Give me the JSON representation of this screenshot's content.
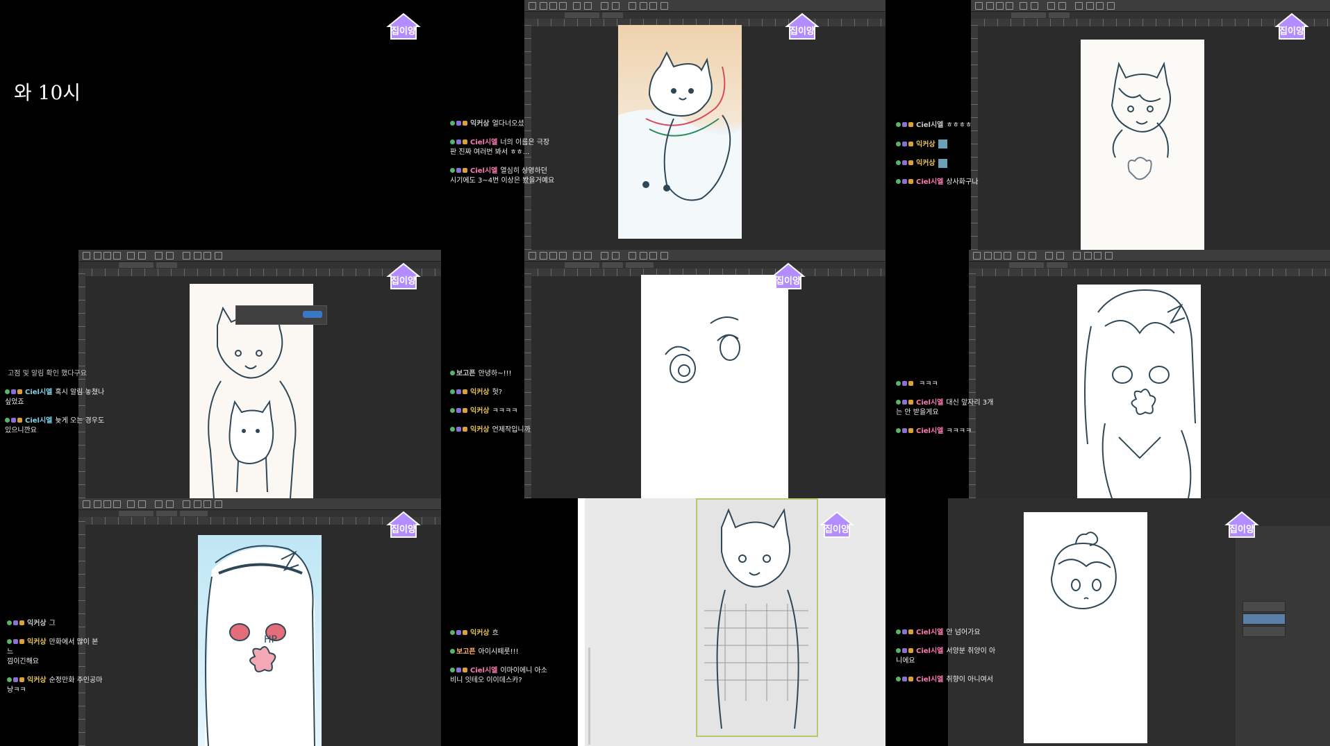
{
  "overlay": {
    "big_text": "와  10시"
  },
  "chats": {
    "p2": [
      {
        "nick": "익커상",
        "color": "#c9c9c9",
        "text": "얼다너오셨"
      },
      {
        "nick": "Ciel시엘",
        "color": "#ff7ab0",
        "text": "너의 이름은 극장\n판 진짜 여러번 봐서 ㅎㅎ..."
      },
      {
        "nick": "Ciel시엘",
        "color": "#ff7ab0",
        "text": "열심히 상영하던\n시기에도 3~4번 이상은 봤을거예요"
      }
    ],
    "p3": [
      {
        "nick": "Ciel시엘",
        "color": "#c9c9c9",
        "text": "ㅎㅎㅎㅎ"
      },
      {
        "nick": "익커상",
        "color": "#e6c458",
        "text": ""
      },
      {
        "nick": "익커상",
        "color": "#e6c458",
        "text": ""
      },
      {
        "nick": "Ciel시엘",
        "color": "#ff7ab0",
        "text": "상사화구나"
      }
    ],
    "p4": [
      {
        "nick": "",
        "color": "#c9c9c9",
        "text": "고점 및 알림 확인 했다구요"
      },
      {
        "nick": "Ciel시엘",
        "color": "#7fd3e8",
        "text": "혹시 알림 놓쳤나\n싶었죠"
      },
      {
        "nick": "Ciel시엘",
        "color": "#7fd3e8",
        "text": "늦게 오는 경우도\n있으니깐요"
      }
    ],
    "p5": [
      {
        "nick": "보고픈",
        "color": "#c9c9c9",
        "text": "안녕하~!!!"
      },
      {
        "nick": "익커상",
        "color": "#e6c458",
        "text": "헛?"
      },
      {
        "nick": "익커상",
        "color": "#e6c458",
        "text": "ㅋㅋㅋㅋ"
      },
      {
        "nick": "익커상",
        "color": "#e6c458",
        "text": "언제작입니까"
      }
    ],
    "p6": [
      {
        "nick": "",
        "color": "#c9c9c9",
        "text": "ㅋㅋㅋ"
      },
      {
        "nick": "Ciel시엘",
        "color": "#ff7ab0",
        "text": "대신 앞자리 3개\n는 안 받을게요"
      },
      {
        "nick": "Ciel시엘",
        "color": "#ff7ab0",
        "text": "ㅋㅋㅋㅋ"
      }
    ],
    "p7": [
      {
        "nick": "익커상",
        "color": "#c9c9c9",
        "text": "그"
      },
      {
        "nick": "익커상",
        "color": "#e6c458",
        "text": "만화에서 많이 본 느\n낌이긴해요"
      },
      {
        "nick": "익커상",
        "color": "#e6c458",
        "text": "순정만화 주인공마\n냥ㅋㅋ"
      }
    ],
    "p8": [
      {
        "nick": "익커상",
        "color": "#e6c458",
        "text": "흐"
      },
      {
        "nick": "보고픈",
        "color": "#ffb070",
        "text": "아이시떼룻!!!"
      },
      {
        "nick": "Ciel시엘",
        "color": "#ff7ab0",
        "text": "이마이에니 아소\n비니 잇테오 이이데스카?"
      }
    ],
    "p9": [
      {
        "nick": "Ciel시엘",
        "color": "#ff7ab0",
        "text": "안 넘어가요"
      },
      {
        "nick": "Ciel시엘",
        "color": "#ff7ab0",
        "text": "서양분 취양이 아\n니에요"
      },
      {
        "nick": "Ciel시엘",
        "color": "#ff7ab0",
        "text": "취향이 아니여서"
      }
    ]
  },
  "logo": {
    "color_fill": "#b38cff",
    "color_stroke": "#ffffff",
    "text": "집이양"
  }
}
